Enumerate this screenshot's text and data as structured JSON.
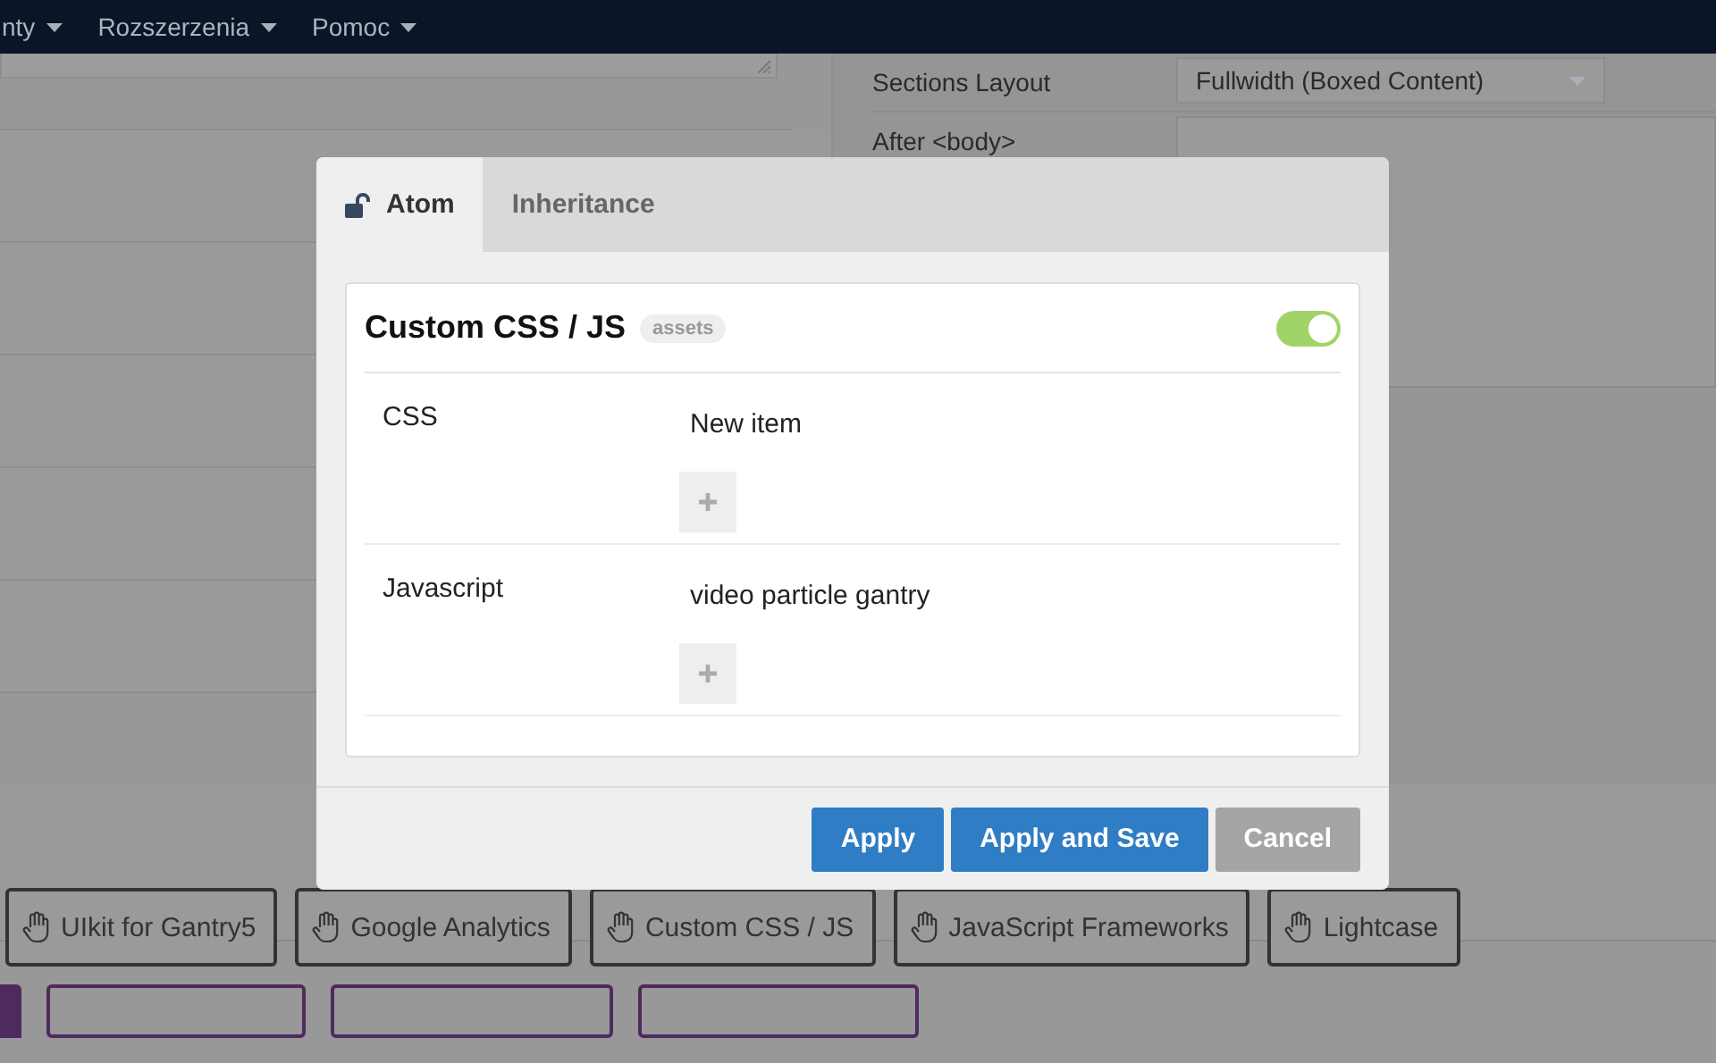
{
  "navbar": {
    "menus": [
      {
        "label": "nty"
      },
      {
        "label": "Rozszerzenia"
      },
      {
        "label": "Pomoc"
      }
    ]
  },
  "settings": [
    {
      "label": "Sections Layout",
      "value": "Fullwidth (Boxed Content)"
    },
    {
      "label": "After <body>"
    }
  ],
  "particles": [
    "UIkit for Gantry5",
    "Google Analytics",
    "Custom CSS / JS",
    "JavaScript Frameworks",
    "Lightcase"
  ],
  "modal": {
    "tabs": [
      {
        "label": "Atom",
        "selected": true
      },
      {
        "label": "Inheritance",
        "selected": false
      }
    ],
    "card": {
      "title": "Custom CSS / JS",
      "badge": "assets",
      "enabled": true,
      "fields": [
        {
          "label": "CSS",
          "items": [
            "New item"
          ]
        },
        {
          "label": "Javascript",
          "items": [
            "video particle gantry"
          ]
        }
      ]
    },
    "buttons": [
      {
        "label": "Apply",
        "kind": "primary"
      },
      {
        "label": "Apply and Save",
        "kind": "primary"
      },
      {
        "label": "Cancel",
        "kind": "secondary"
      }
    ]
  }
}
